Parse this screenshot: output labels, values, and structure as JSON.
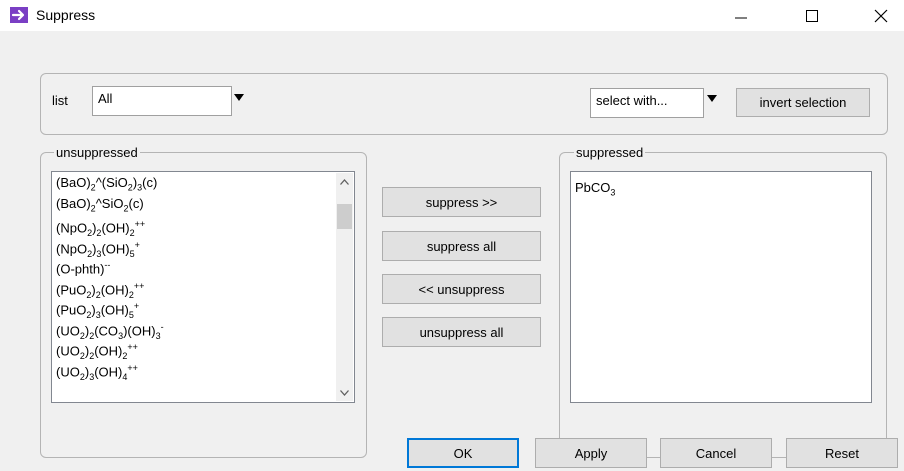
{
  "window": {
    "title": "Suppress",
    "minimize_glyph": "—",
    "maximize_glyph": "☐",
    "close_glyph": "✕"
  },
  "filter": {
    "list_label": "list",
    "list_value": "All",
    "select_with_value": "select with...",
    "invert_selection_label": "invert selection"
  },
  "unsuppressed": {
    "legend": "unsuppressed",
    "items": [
      "(BaO)2^(SiO2)3(c)",
      "(BaO)2^SiO2(c)",
      "(NpO2)2(OH)2++",
      "(NpO2)3(OH)5+",
      "(O-phth)--",
      "(PuO2)2(OH)2++",
      "(PuO2)3(OH)5+",
      "(UO2)2(CO3)(OH)3-",
      "(UO2)2(OH)2++",
      "(UO2)3(OH)4++"
    ]
  },
  "actions": {
    "suppress": "suppress >>",
    "suppress_all": "suppress all",
    "unsuppress": "<< unsuppress",
    "unsuppress_all": "unsuppress all"
  },
  "suppressed": {
    "legend": "suppressed",
    "items": [
      "PbCO3"
    ]
  },
  "footer": {
    "ok": "OK",
    "apply": "Apply",
    "cancel": "Cancel",
    "reset": "Reset"
  },
  "colors": {
    "app_icon": "#7a3fc4",
    "default_button_border": "#0078d7"
  }
}
